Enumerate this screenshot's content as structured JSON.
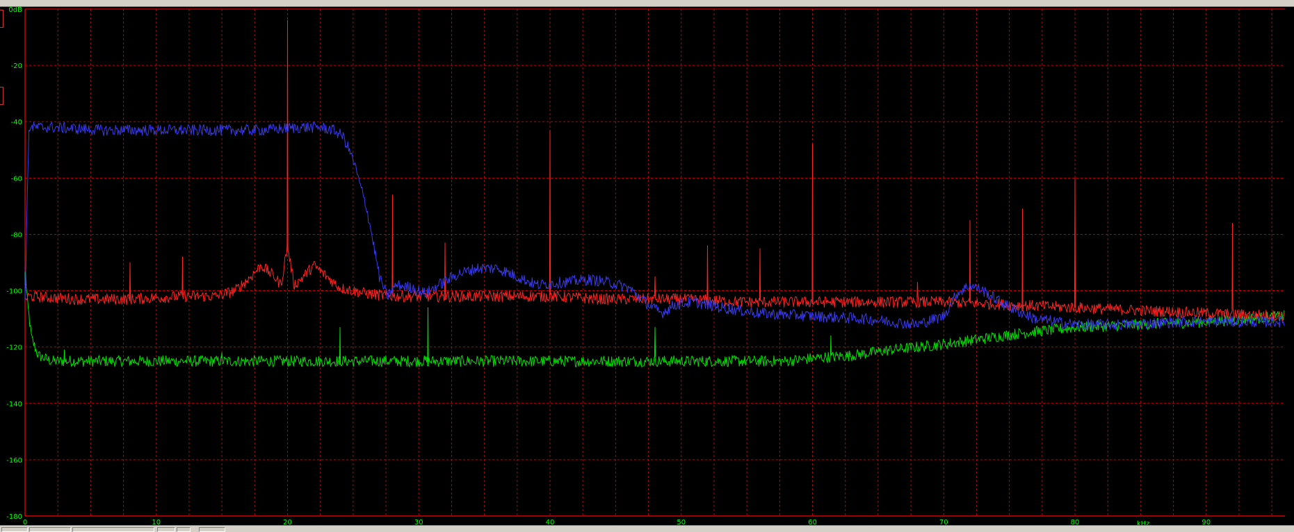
{
  "chart_data": {
    "type": "line",
    "xlim": [
      0,
      96
    ],
    "ylim": [
      -180,
      0
    ],
    "x_unit": "kHz",
    "y_unit": "dB",
    "x_ticks": [
      0,
      10,
      20,
      30,
      40,
      50,
      60,
      70,
      80,
      90
    ],
    "x_tick_labels": [
      "0",
      "10",
      "20",
      "30",
      "40",
      "50",
      "60",
      "70",
      "80",
      "90"
    ],
    "y_ticks": [
      0,
      -20,
      -40,
      -60,
      -80,
      -100,
      -120,
      -140,
      -160,
      -180
    ],
    "y_tick_labels": [
      "0dB",
      "-20",
      "-40",
      "-60",
      "-80",
      "-100",
      "-120",
      "-140",
      "-160",
      "-180"
    ],
    "x_minor_step": 2.5,
    "grid": true,
    "legend": "none",
    "colors": {
      "background": "#000000",
      "axis": "#ff0000",
      "grid": "#c00000",
      "tick_text": "#00ff00"
    },
    "series": [
      {
        "color": "#3a3af2",
        "x": [
          0,
          0.3,
          2,
          6,
          10,
          14,
          18,
          21,
          22.5,
          23.5,
          24.2,
          24.7,
          25.1,
          25.5,
          26,
          26.5,
          27,
          27.6,
          28.3,
          29.5,
          30.5,
          31.5,
          33,
          34.5,
          36,
          37.5,
          39,
          41,
          43,
          44.5,
          46,
          47,
          47.8,
          48.5,
          49.5,
          51,
          53,
          56,
          60,
          64,
          68,
          70,
          71,
          72,
          73,
          75,
          77,
          80,
          84,
          88,
          92,
          96
        ],
        "y": [
          -103,
          -42,
          -42,
          -43,
          -43,
          -43,
          -43,
          -42,
          -42,
          -43,
          -45,
          -50,
          -55,
          -62,
          -70,
          -82,
          -95,
          -102,
          -98,
          -99,
          -101,
          -98,
          -94,
          -92,
          -92,
          -95,
          -98,
          -97,
          -96,
          -97,
          -99,
          -103,
          -106,
          -108,
          -105,
          -104,
          -106,
          -108,
          -109,
          -110,
          -112,
          -109,
          -101,
          -98,
          -100,
          -106,
          -110,
          -112,
          -112,
          -111,
          -111,
          -111
        ]
      },
      {
        "color": "#ff2424",
        "x": [
          0,
          0.3,
          4,
          8,
          12,
          14.5,
          16,
          17,
          18,
          19,
          19.5,
          20,
          20.5,
          21,
          22,
          23,
          24,
          26,
          28,
          32,
          36,
          40,
          44,
          48,
          50,
          55,
          60,
          65,
          70,
          75,
          80,
          85,
          90,
          96
        ],
        "y": [
          -103,
          -102,
          -103,
          -103,
          -102,
          -102,
          -100,
          -96,
          -91,
          -95,
          -98,
          -84,
          -98,
          -96,
          -91,
          -95,
          -99,
          -101,
          -102,
          -102,
          -102,
          -102,
          -103,
          -103,
          -103,
          -104,
          -104,
          -104,
          -104,
          -105,
          -106,
          -107,
          -108,
          -109
        ],
        "spikes": [
          [
            20,
            -4
          ],
          [
            40,
            -43
          ],
          [
            60,
            -48
          ],
          [
            80,
            -60
          ],
          [
            28,
            -66
          ],
          [
            72,
            -75
          ],
          [
            76,
            -71
          ],
          [
            92,
            -76
          ],
          [
            32,
            -83
          ],
          [
            52,
            -84
          ],
          [
            56,
            -85
          ],
          [
            8,
            -90
          ],
          [
            12,
            -88
          ],
          [
            48,
            -95
          ],
          [
            68,
            -97
          ]
        ]
      },
      {
        "color": "#00e000",
        "x": [
          0,
          0.2,
          0.5,
          1,
          2,
          5,
          10,
          15,
          20,
          25,
          30,
          35,
          40,
          45,
          50,
          55,
          58,
          60,
          63,
          66,
          70,
          73,
          76,
          80,
          85,
          90,
          96
        ],
        "y": [
          -94,
          -105,
          -117,
          -123,
          -125,
          -125,
          -125,
          -125,
          -125,
          -125,
          -125,
          -125,
          -125,
          -125,
          -125,
          -125,
          -125,
          -124,
          -123,
          -121,
          -119,
          -117,
          -115,
          -113,
          -112,
          -111,
          -109
        ],
        "spikes": [
          [
            24,
            -113
          ],
          [
            30.7,
            -106
          ],
          [
            48,
            -113
          ],
          [
            61.4,
            -116
          ],
          [
            15,
            -122
          ],
          [
            3,
            -121
          ],
          [
            0.05,
            -93
          ]
        ]
      }
    ]
  }
}
